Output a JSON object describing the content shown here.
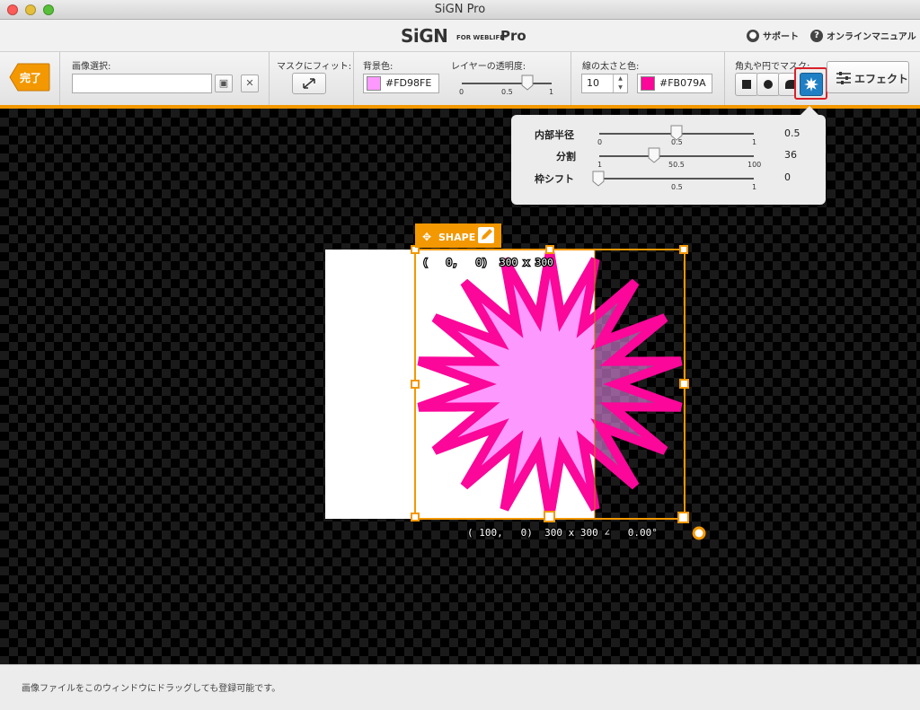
{
  "window": {
    "title": "SiGN Pro"
  },
  "header": {
    "brand": "SiGN",
    "brand_sub": "FOR WEBLIFE*",
    "brand_pro": "Pro",
    "support_label": "サポート",
    "manual_label": "オンラインマニュアル"
  },
  "toolbar": {
    "done_label": "完了",
    "image_select_label": "画像選択:",
    "image_select_value": "",
    "fit_mask_label": "マスクにフィット:",
    "bg_color_label": "背景色:",
    "bg_color_hex": "#FD98FE",
    "layer_opacity_label": "レイヤーの透明度:",
    "opacity_ticks": [
      "0",
      "0.5",
      "1"
    ],
    "opacity_value": 0.9,
    "line_label": "線の太さと色:",
    "line_width": "10",
    "line_color_hex": "#FB079A",
    "mask_label": "角丸や円でマスク:",
    "effect_label": "エフェクト"
  },
  "popover": {
    "inner_radius_label": "内部半径",
    "inner_radius_ticks": [
      "0",
      "0.5",
      "1"
    ],
    "inner_radius_value": "0.5",
    "divisions_label": "分割",
    "divisions_ticks": [
      "1",
      "50.5",
      "100"
    ],
    "divisions_value": "36",
    "frame_shift_label": "枠シフト",
    "frame_shift_ticks": [
      "0",
      "0.5",
      "1"
    ],
    "frame_shift_value": "0"
  },
  "canvas": {
    "shape_tab_label": "SHAPE",
    "top_readout": "(   0,   0)  300 x 300",
    "bottom_readout": "( 100,   0)  300 x 300 ∠   0.00°",
    "star_fill_color": "#FD98FE",
    "star_stroke_color": "#FB079A",
    "selection_color": "#F39800"
  },
  "footer": {
    "hint": "画像ファイルをこのウィンドウにドラッグしても登録可能です。"
  }
}
